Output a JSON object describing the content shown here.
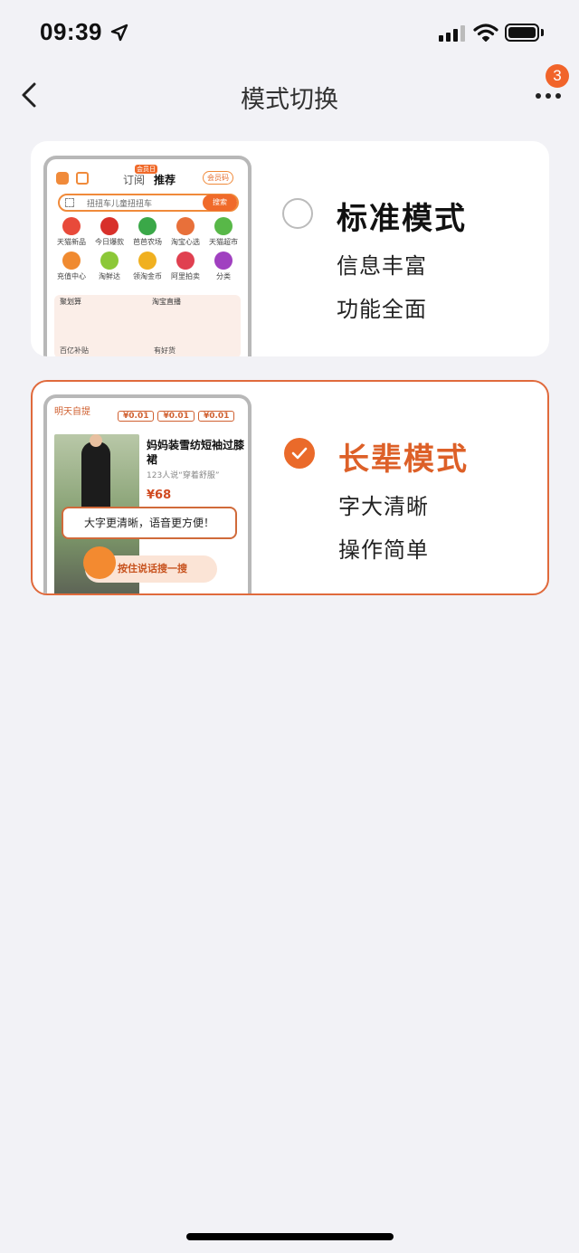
{
  "status": {
    "time": "09:39"
  },
  "nav": {
    "title": "模式切换",
    "badge_count": "3"
  },
  "modes": [
    {
      "title": "标准模式",
      "line1": "信息丰富",
      "line2": "功能全面",
      "selected": false
    },
    {
      "title": "长辈模式",
      "line1": "字大清晰",
      "line2": "操作简单",
      "selected": true
    }
  ],
  "standard_preview": {
    "tab_subscribe": "订阅",
    "tab_recommend": "推荐",
    "vip_tag": "会员日",
    "member_code": "会员码",
    "search_query": "扭扭车儿童扭扭车",
    "search_button": "搜索",
    "grid": [
      "天猫新品",
      "今日爆款",
      "芭芭农场",
      "淘宝心选",
      "天猫超市",
      "充值中心",
      "淘鲜达",
      "领淘金币",
      "阿里拍卖",
      "分类"
    ],
    "promo_left": "聚划算",
    "promo_right": "淘宝直播",
    "foot_left": "百亿补贴",
    "foot_right": "有好货"
  },
  "elder_preview": {
    "header": "明天自提",
    "prices": [
      "¥0.01",
      "¥0.01",
      "¥0.01"
    ],
    "product_name": "妈妈装雪纺短袖过膝裙",
    "product_sub": "123人说“穿着舒服”",
    "product_price": "¥68",
    "tip": "大字更清晰，语音更方便！",
    "voice_button": "按住说话搜一搜"
  },
  "colors": {
    "accent": "#ea6a2a",
    "background": "#f2f2f6"
  }
}
